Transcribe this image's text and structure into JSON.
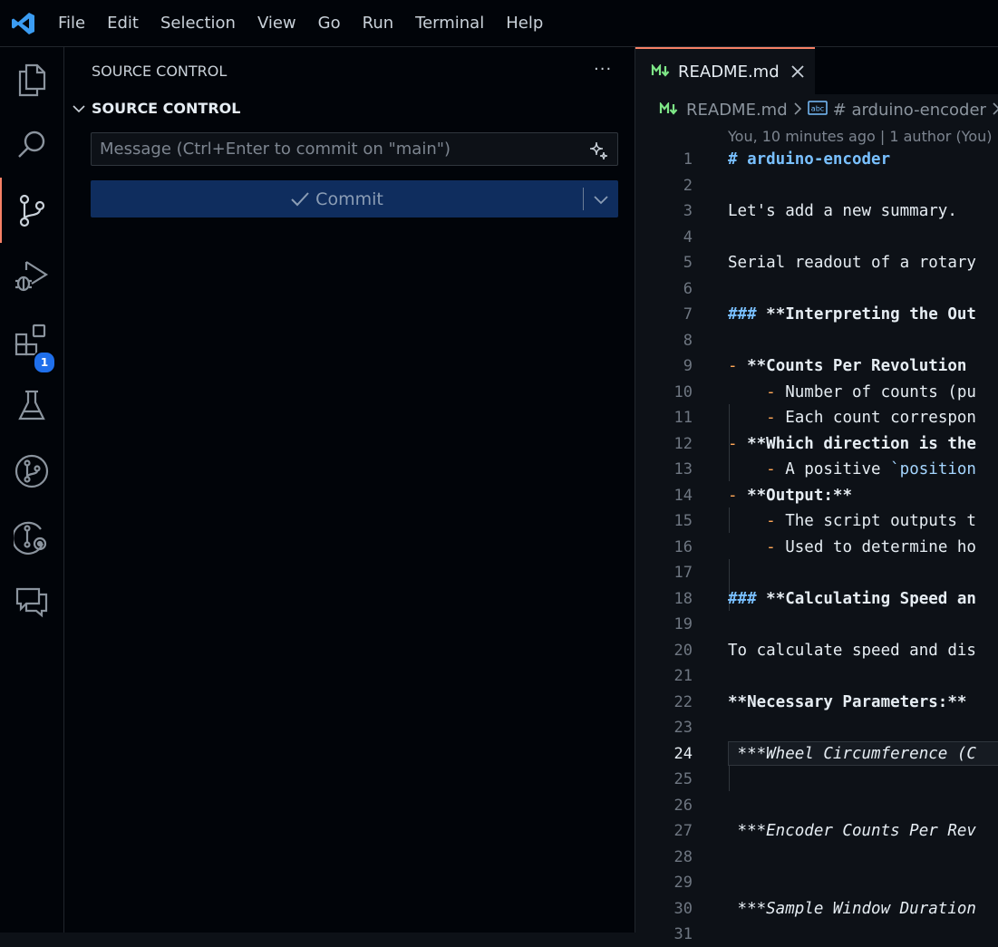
{
  "menu": [
    "File",
    "Edit",
    "Selection",
    "View",
    "Go",
    "Run",
    "Terminal",
    "Help"
  ],
  "activity_bar": {
    "items": [
      {
        "icon": "files-icon"
      },
      {
        "icon": "search-icon"
      },
      {
        "icon": "source-control-icon",
        "active": true
      },
      {
        "icon": "run-debug-icon"
      },
      {
        "icon": "extensions-icon",
        "badge": "1"
      },
      {
        "icon": "testing-icon"
      },
      {
        "icon": "git-graph-icon"
      },
      {
        "icon": "git-lens-icon"
      },
      {
        "icon": "comments-icon"
      }
    ],
    "extensions_badge": "1"
  },
  "sidebar": {
    "title": "SOURCE CONTROL",
    "more": "···",
    "section_label": "SOURCE CONTROL",
    "message_placeholder": "Message (Ctrl+Enter to commit on \"main\")",
    "commit_label": "Commit"
  },
  "editor": {
    "tab_label": "README.md",
    "breadcrumb": {
      "file": "README.md",
      "symbol": "# arduino-encoder"
    },
    "blame": "You, 10 minutes ago | 1 author (You)",
    "current_line": 24,
    "lines": [
      {
        "n": "1",
        "html": "<span class=\"h\"># arduino-encoder</span>"
      },
      {
        "n": "2",
        "html": ""
      },
      {
        "n": "3",
        "html": "Let's add a new summary."
      },
      {
        "n": "4",
        "html": ""
      },
      {
        "n": "5",
        "html": "Serial readout of a rotary"
      },
      {
        "n": "6",
        "html": ""
      },
      {
        "n": "7",
        "html": "<span class=\"h\">### </span><span class=\"b\">**Interpreting the Out</span>"
      },
      {
        "n": "8",
        "html": ""
      },
      {
        "n": "9",
        "html": "<span class=\"dash\">-</span> <span class=\"b\">**Counts Per Revolution</span>"
      },
      {
        "n": "10",
        "html": "    <span class=\"dash\">-</span> Number of counts (pu"
      },
      {
        "n": "11",
        "html": "    <span class=\"dash\">-</span> Each count correspon"
      },
      {
        "n": "12",
        "html": "<span class=\"dash\">-</span> <span class=\"b\">**Which direction is the</span>"
      },
      {
        "n": "13",
        "html": "    <span class=\"dash\">-</span> A positive <span class=\"ic\">`position</span>"
      },
      {
        "n": "14",
        "html": "<span class=\"dash\">-</span> <span class=\"b\">**Output:**</span>"
      },
      {
        "n": "15",
        "html": "    <span class=\"dash\">-</span> The script outputs t"
      },
      {
        "n": "16",
        "html": "    <span class=\"dash\">-</span> Used to determine ho"
      },
      {
        "n": "17",
        "html": ""
      },
      {
        "n": "18",
        "html": "<span class=\"h\">### </span><span class=\"b\">**Calculating Speed an</span>"
      },
      {
        "n": "19",
        "html": ""
      },
      {
        "n": "20",
        "html": "To calculate speed and dis"
      },
      {
        "n": "21",
        "html": ""
      },
      {
        "n": "22",
        "html": "<span class=\"b\">**Necessary Parameters:**</span>"
      },
      {
        "n": "23",
        "html": ""
      },
      {
        "n": "24",
        "html": " **<span class=\"it\">*Wheel Circumference (C</span>"
      },
      {
        "n": "25",
        "html": ""
      },
      {
        "n": "26",
        "html": ""
      },
      {
        "n": "27",
        "html": " **<span class=\"it\">*Encoder Counts Per Rev</span>"
      },
      {
        "n": "28",
        "html": ""
      },
      {
        "n": "29",
        "html": ""
      },
      {
        "n": "30",
        "html": " **<span class=\"it\">*Sample Window Duration</span>"
      },
      {
        "n": "31",
        "html": ""
      }
    ]
  }
}
